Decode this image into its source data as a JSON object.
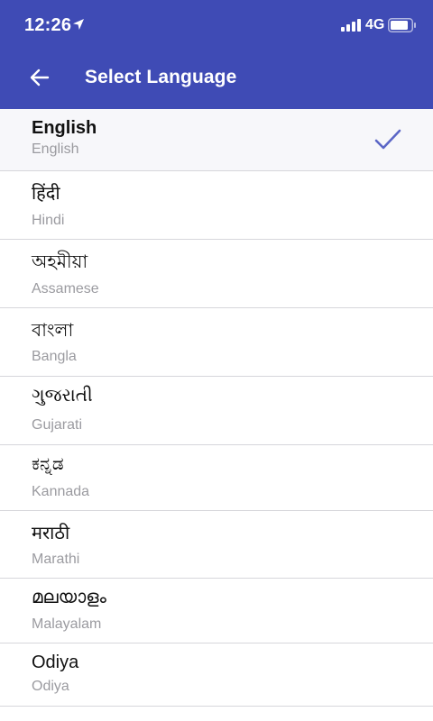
{
  "status_bar": {
    "time": "12:26",
    "network": "4G",
    "icons": [
      "location-arrow-icon",
      "signal-bars-icon",
      "battery-icon"
    ]
  },
  "toolbar": {
    "title": "Select Language",
    "back_icon": "arrow-left-icon"
  },
  "languages": [
    {
      "native": "English",
      "english": "English",
      "selected": true
    },
    {
      "native": "हिंदी",
      "english": "Hindi",
      "selected": false
    },
    {
      "native": "অহমীয়া",
      "english": "Assamese",
      "selected": false
    },
    {
      "native": "বাংলা",
      "english": "Bangla",
      "selected": false
    },
    {
      "native": "ગુજરાતી",
      "english": "Gujarati",
      "selected": false
    },
    {
      "native": "ಕನ್ನಡ",
      "english": "Kannada",
      "selected": false
    },
    {
      "native": "मराठी",
      "english": "Marathi",
      "selected": false
    },
    {
      "native": "മലയാളം",
      "english": "Malayalam",
      "selected": false
    },
    {
      "native": "Odiya",
      "english": "Odiya",
      "selected": false
    }
  ],
  "colors": {
    "header": "#3f4bb5",
    "check": "#5b66c6",
    "secondary_text": "#9b9ba0"
  }
}
